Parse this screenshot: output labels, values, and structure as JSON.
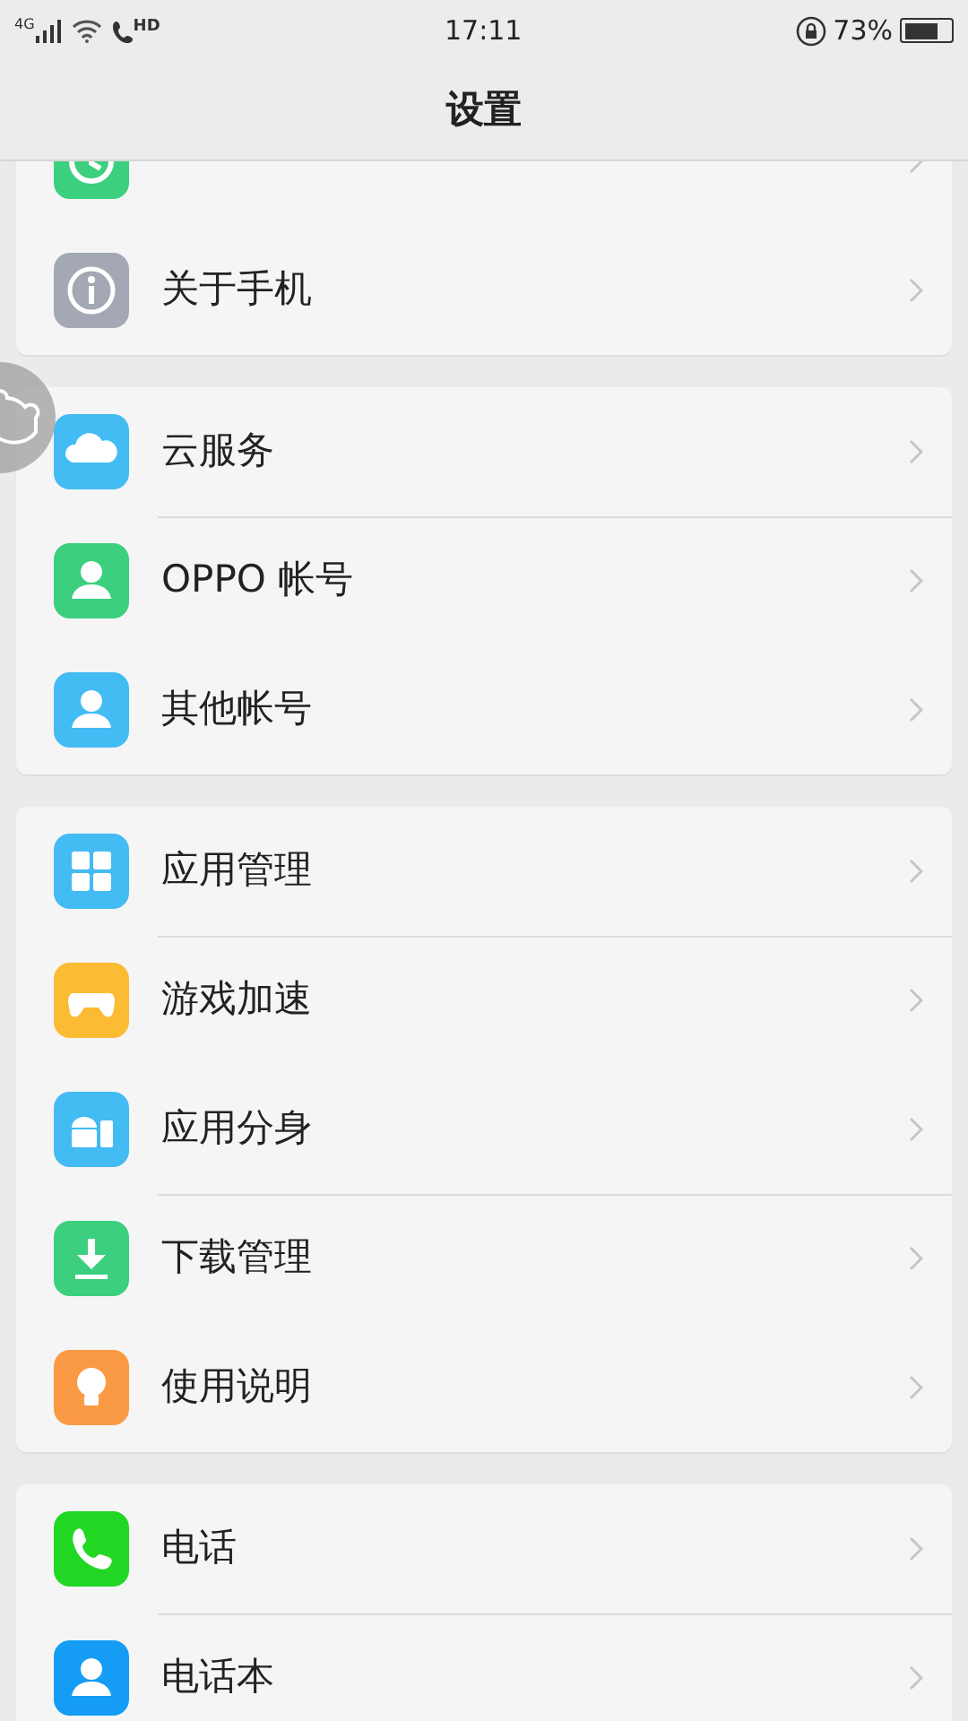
{
  "status_bar": {
    "network": "4G",
    "call_badge": "HD",
    "time": "17:11",
    "battery": "73%"
  },
  "header": {
    "title": "设置"
  },
  "groups": [
    {
      "items": [
        {
          "kind": "update",
          "color": "#3ccf7f"
        },
        {
          "kind": "info",
          "label": "关于手机",
          "color": "#a3a8b4",
          "divider": false
        }
      ]
    },
    {
      "items": [
        {
          "kind": "cloud",
          "label": "云服务",
          "color": "#43bbf3",
          "divider": false
        },
        {
          "kind": "person",
          "label": "OPPO 帐号",
          "color": "#3ccf7f",
          "divider": true
        },
        {
          "kind": "person",
          "label": "其他帐号",
          "color": "#43bbf3",
          "divider": false
        }
      ]
    },
    {
      "items": [
        {
          "kind": "grid",
          "label": "应用管理",
          "color": "#43bbf3",
          "divider": false
        },
        {
          "kind": "gamepad",
          "label": "游戏加速",
          "color": "#fbbb32",
          "divider": true
        },
        {
          "kind": "android",
          "label": "应用分身",
          "color": "#43bbf3",
          "divider": false
        },
        {
          "kind": "download",
          "label": "下载管理",
          "color": "#3ccf7f",
          "divider": true
        },
        {
          "kind": "bulb",
          "label": "使用说明",
          "color": "#fb9a45",
          "divider": false
        }
      ]
    },
    {
      "items": [
        {
          "kind": "phone",
          "label": "电话",
          "color": "#22d624",
          "divider": false
        },
        {
          "kind": "person",
          "label": "电话本",
          "color": "#159cf5",
          "divider": true
        }
      ]
    }
  ]
}
